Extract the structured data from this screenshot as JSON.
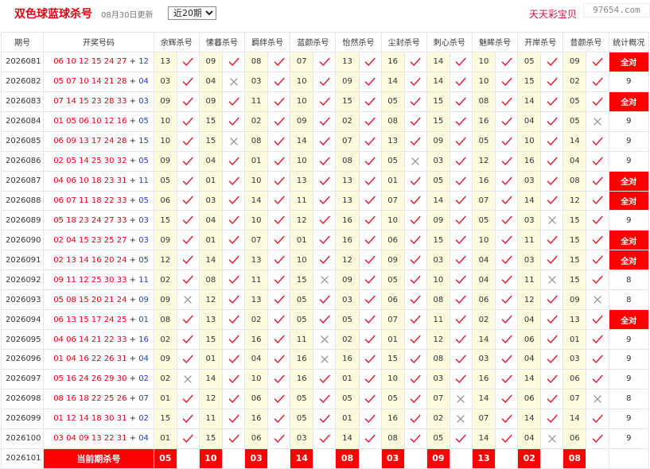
{
  "header": {
    "title": "双色球蓝球杀号",
    "update_text": "08月30日更新",
    "period_selected": "近20期",
    "brand": "天天彩宝贝",
    "watermark": "97654.com"
  },
  "table": {
    "columns": [
      "期号",
      "开奖号码",
      "余辉杀号",
      "愫暮杀号",
      "羁绊杀号",
      "蓝颜杀号",
      "怡然杀号",
      "尘封杀号",
      "刺心杀号",
      "魅眸杀号",
      "开岸杀号",
      "昔颜杀号",
      "统计概况"
    ],
    "rows": [
      {
        "issue": "2026081",
        "red": "06 10 12 15 24 27",
        "blue": "12",
        "kills": [
          "13",
          "09",
          "08",
          "07",
          "13",
          "16",
          "14",
          "10",
          "05",
          "09"
        ],
        "hits": [
          1,
          1,
          1,
          1,
          1,
          1,
          1,
          1,
          1,
          1
        ],
        "summary": "全对"
      },
      {
        "issue": "2026082",
        "red": "05 07 10 14 21 28",
        "blue": "04",
        "kills": [
          "03",
          "04",
          "03",
          "10",
          "09",
          "14",
          "14",
          "10",
          "15",
          "02"
        ],
        "hits": [
          1,
          0,
          1,
          1,
          1,
          1,
          1,
          1,
          1,
          1
        ],
        "summary": "9"
      },
      {
        "issue": "2026083",
        "red": "07 14 15 23 28 33",
        "blue": "03",
        "kills": [
          "09",
          "09",
          "11",
          "10",
          "15",
          "05",
          "15",
          "08",
          "14",
          "05"
        ],
        "hits": [
          1,
          1,
          1,
          1,
          1,
          1,
          1,
          1,
          1,
          1
        ],
        "summary": "全对"
      },
      {
        "issue": "2026084",
        "red": "01 05 06 10 12 16",
        "blue": "05",
        "kills": [
          "10",
          "15",
          "02",
          "09",
          "02",
          "08",
          "15",
          "16",
          "04",
          "05"
        ],
        "hits": [
          1,
          1,
          1,
          1,
          1,
          1,
          1,
          1,
          1,
          0
        ],
        "summary": "9"
      },
      {
        "issue": "2026085",
        "red": "06 09 13 17 24 28",
        "blue": "15",
        "kills": [
          "10",
          "15",
          "08",
          "14",
          "07",
          "13",
          "09",
          "05",
          "10",
          "14"
        ],
        "hits": [
          1,
          0,
          1,
          1,
          1,
          1,
          1,
          1,
          1,
          1
        ],
        "summary": "9"
      },
      {
        "issue": "2026086",
        "red": "02 05 14 25 30 32",
        "blue": "05",
        "kills": [
          "09",
          "04",
          "01",
          "10",
          "08",
          "05",
          "03",
          "12",
          "16",
          "04"
        ],
        "hits": [
          1,
          1,
          1,
          1,
          1,
          0,
          1,
          1,
          1,
          1
        ],
        "summary": "9"
      },
      {
        "issue": "2026087",
        "red": "04 06 10 18 23 31",
        "blue": "11",
        "kills": [
          "05",
          "01",
          "10",
          "13",
          "13",
          "01",
          "05",
          "16",
          "03",
          "08"
        ],
        "hits": [
          1,
          1,
          1,
          1,
          1,
          1,
          1,
          1,
          1,
          1
        ],
        "summary": "全对"
      },
      {
        "issue": "2026088",
        "red": "06 07 11 18 22 33",
        "blue": "05",
        "kills": [
          "06",
          "03",
          "14",
          "11",
          "13",
          "07",
          "14",
          "07",
          "14",
          "12"
        ],
        "hits": [
          1,
          1,
          1,
          1,
          1,
          1,
          1,
          1,
          1,
          1
        ],
        "summary": "全对"
      },
      {
        "issue": "2026089",
        "red": "05 18 23 24 27 33",
        "blue": "03",
        "kills": [
          "15",
          "04",
          "10",
          "12",
          "16",
          "10",
          "09",
          "05",
          "03",
          "15"
        ],
        "hits": [
          1,
          1,
          1,
          1,
          1,
          1,
          1,
          1,
          0,
          1
        ],
        "summary": "9"
      },
      {
        "issue": "2026090",
        "red": "02 04 15 23 25 27",
        "blue": "03",
        "kills": [
          "09",
          "01",
          "07",
          "01",
          "16",
          "06",
          "15",
          "10",
          "11",
          "15"
        ],
        "hits": [
          1,
          1,
          1,
          1,
          1,
          1,
          1,
          1,
          1,
          1
        ],
        "summary": "全对"
      },
      {
        "issue": "2026091",
        "red": "02 13 14 16 20 24",
        "blue": "05",
        "kills": [
          "12",
          "14",
          "13",
          "10",
          "12",
          "09",
          "03",
          "04",
          "03",
          "15"
        ],
        "hits": [
          1,
          1,
          1,
          1,
          1,
          1,
          1,
          1,
          1,
          1
        ],
        "summary": "全对"
      },
      {
        "issue": "2026092",
        "red": "09 11 12 25 30 33",
        "blue": "11",
        "kills": [
          "02",
          "08",
          "11",
          "15",
          "09",
          "05",
          "10",
          "04",
          "11",
          "15"
        ],
        "hits": [
          1,
          1,
          1,
          0,
          1,
          1,
          1,
          1,
          0,
          1
        ],
        "summary": "8"
      },
      {
        "issue": "2026093",
        "red": "05 08 15 20 21 24",
        "blue": "09",
        "kills": [
          "09",
          "12",
          "13",
          "05",
          "03",
          "06",
          "08",
          "06",
          "12",
          "09"
        ],
        "hits": [
          0,
          1,
          1,
          1,
          1,
          1,
          1,
          1,
          1,
          0
        ],
        "summary": "8"
      },
      {
        "issue": "2026094",
        "red": "06 13 15 17 24 25",
        "blue": "01",
        "kills": [
          "08",
          "13",
          "02",
          "05",
          "05",
          "07",
          "11",
          "02",
          "04",
          "13"
        ],
        "hits": [
          1,
          1,
          1,
          1,
          1,
          1,
          1,
          1,
          1,
          1
        ],
        "summary": "全对"
      },
      {
        "issue": "2026095",
        "red": "04 06 14 21 22 33",
        "blue": "16",
        "kills": [
          "02",
          "15",
          "16",
          "11",
          "02",
          "01",
          "12",
          "14",
          "06",
          "01"
        ],
        "hits": [
          1,
          1,
          1,
          0,
          1,
          1,
          1,
          1,
          1,
          1
        ],
        "summary": "9"
      },
      {
        "issue": "2026096",
        "red": "01 04 16 22 26 31",
        "blue": "04",
        "kills": [
          "09",
          "01",
          "04",
          "16",
          "16",
          "15",
          "08",
          "03",
          "04",
          "03"
        ],
        "hits": [
          1,
          1,
          1,
          0,
          1,
          1,
          1,
          1,
          1,
          1
        ],
        "summary": "9"
      },
      {
        "issue": "2026097",
        "red": "05 16 24 26 29 30",
        "blue": "02",
        "kills": [
          "02",
          "14",
          "10",
          "16",
          "01",
          "10",
          "03",
          "16",
          "14",
          "06"
        ],
        "hits": [
          0,
          1,
          1,
          1,
          1,
          1,
          1,
          1,
          1,
          1
        ],
        "summary": "9"
      },
      {
        "issue": "2026098",
        "red": "08 16 18 22 25 26",
        "blue": "07",
        "kills": [
          "01",
          "12",
          "06",
          "05",
          "05",
          "05",
          "07",
          "14",
          "06",
          "07"
        ],
        "hits": [
          1,
          1,
          1,
          1,
          1,
          1,
          0,
          1,
          1,
          0
        ],
        "summary": "8"
      },
      {
        "issue": "2026099",
        "red": "01 12 14 18 30 31",
        "blue": "02",
        "kills": [
          "15",
          "11",
          "16",
          "05",
          "01",
          "16",
          "02",
          "07",
          "14",
          "14"
        ],
        "hits": [
          1,
          1,
          1,
          1,
          1,
          1,
          0,
          1,
          1,
          1
        ],
        "summary": "9"
      },
      {
        "issue": "2026100",
        "red": "03 04 09 13 22 31",
        "blue": "04",
        "kills": [
          "01",
          "15",
          "06",
          "03",
          "14",
          "08",
          "05",
          "14",
          "04",
          "06"
        ],
        "hits": [
          1,
          1,
          1,
          1,
          1,
          1,
          1,
          1,
          0,
          1
        ],
        "summary": "9"
      }
    ],
    "current": {
      "issue": "2026101",
      "label": "当前期杀号",
      "kills": [
        "05",
        "10",
        "03",
        "14",
        "08",
        "03",
        "09",
        "13",
        "02",
        "08"
      ]
    }
  }
}
